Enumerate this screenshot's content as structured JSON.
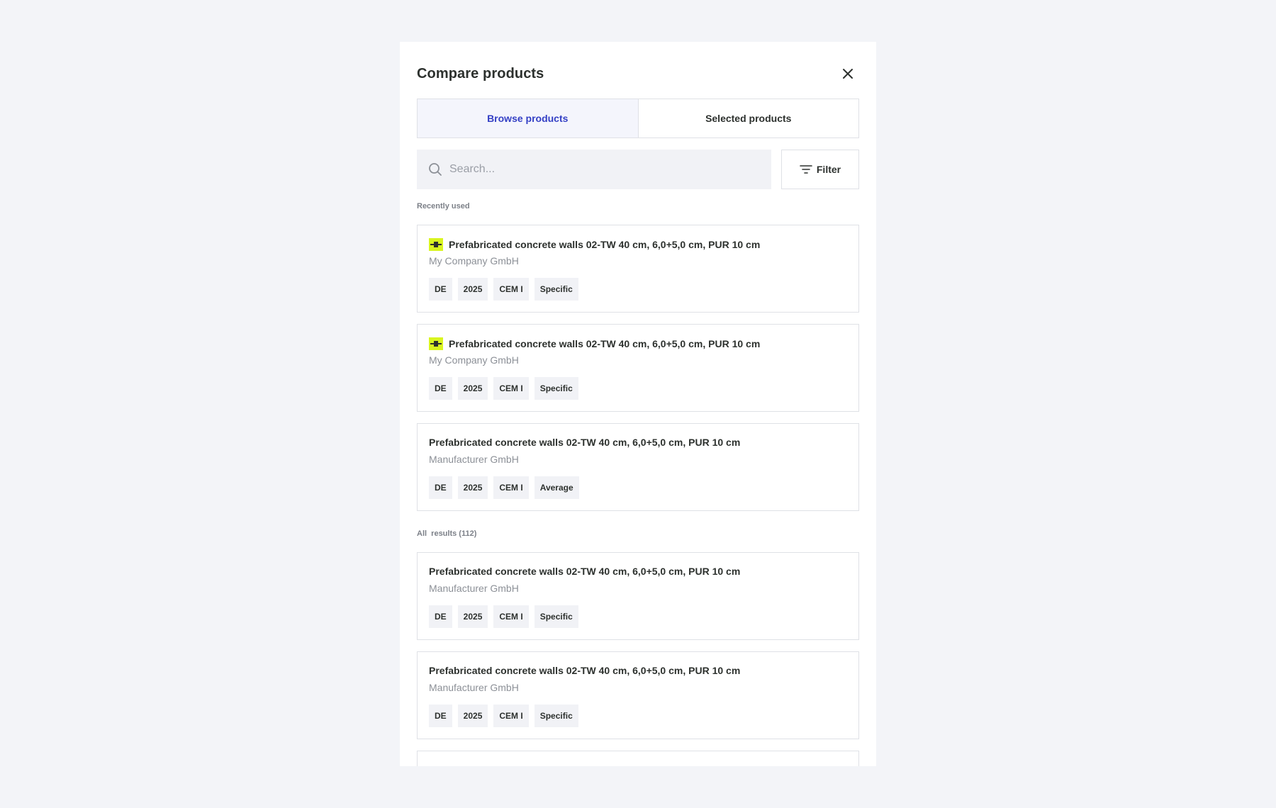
{
  "modal": {
    "title": "Compare products",
    "close_icon": "close-icon"
  },
  "tabs": [
    {
      "label": "Browse products",
      "active": true
    },
    {
      "label": "Selected products",
      "active": false
    }
  ],
  "search": {
    "placeholder": "Search...",
    "value": "",
    "icon": "search-icon"
  },
  "filter": {
    "label": "Filter",
    "icon": "filter-icon"
  },
  "recent": {
    "label": "Recently used",
    "items": [
      {
        "title": "Prefabricated concrete walls 02-TW 40 cm, 6,0+5,0 cm, PUR 10 cm",
        "company": "My Company GmbH",
        "branded": true,
        "tags": [
          "DE",
          "2025",
          "CEM I",
          "Specific"
        ]
      },
      {
        "title": "Prefabricated concrete walls 02-TW 40 cm, 6,0+5,0 cm, PUR 10 cm",
        "company": "My Company GmbH",
        "branded": true,
        "tags": [
          "DE",
          "2025",
          "CEM I",
          "Specific"
        ]
      },
      {
        "title": "Prefabricated concrete walls 02-TW 40 cm, 6,0+5,0 cm, PUR 10 cm",
        "company": "Manufacturer GmbH",
        "branded": false,
        "tags": [
          "DE",
          "2025",
          "CEM I",
          "Average"
        ]
      }
    ]
  },
  "all": {
    "label": "All  results (112)",
    "items": [
      {
        "title": "Prefabricated concrete walls 02-TW 40 cm, 6,0+5,0 cm, PUR 10 cm",
        "company": "Manufacturer GmbH",
        "tags": [
          "DE",
          "2025",
          "CEM I",
          "Specific"
        ]
      },
      {
        "title": "Prefabricated concrete walls 02-TW 40 cm, 6,0+5,0 cm, PUR 10 cm",
        "company": "Manufacturer GmbH",
        "tags": [
          "DE",
          "2025",
          "CEM I",
          "Specific"
        ]
      }
    ]
  },
  "colors": {
    "accent": "#3440c5",
    "brand_highlight": "#d9f520",
    "background": "#f3f4f8"
  }
}
